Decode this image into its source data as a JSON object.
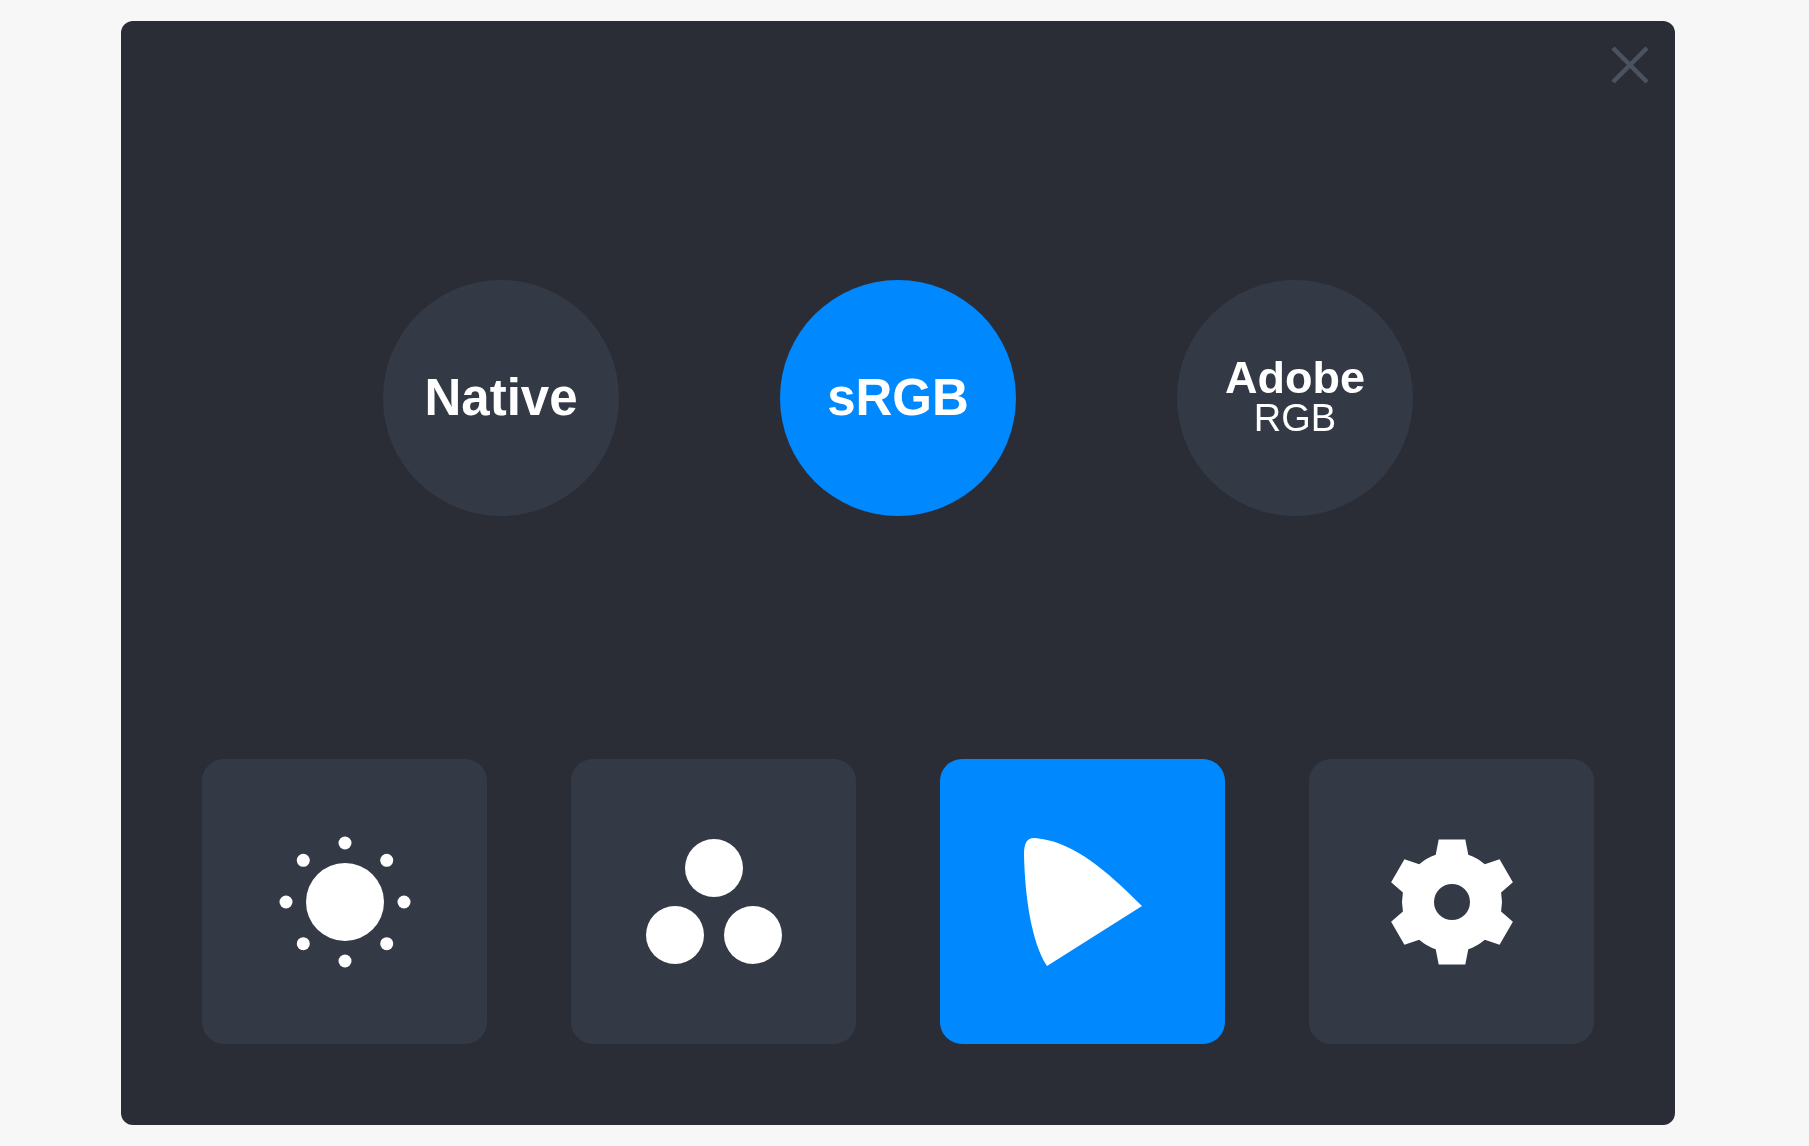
{
  "modes": [
    {
      "label": "Native",
      "selected": false
    },
    {
      "label": "sRGB",
      "selected": true
    },
    {
      "label": "Adobe",
      "sublabel": "RGB",
      "selected": false
    }
  ],
  "tools": [
    {
      "kind": "brightness",
      "selected": false
    },
    {
      "kind": "color",
      "selected": false
    },
    {
      "kind": "gamut",
      "selected": true
    },
    {
      "kind": "settings",
      "selected": false
    }
  ]
}
